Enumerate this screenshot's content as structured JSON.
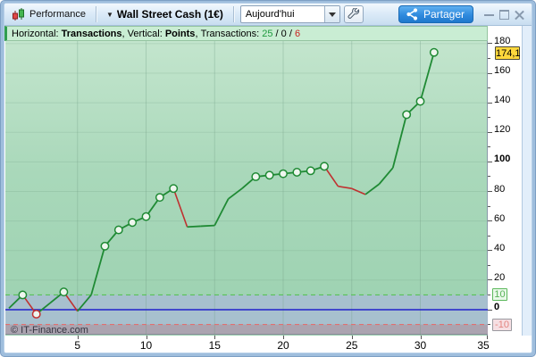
{
  "toolbar": {
    "performance_label": "Performance",
    "instrument_dropdown": "Wall Street Cash (1€)",
    "chevron": "▼",
    "timeframe_value": "Aujourd'hui",
    "share_label": "Partager"
  },
  "info_bar": {
    "horizontal_label": "Horizontal: ",
    "horizontal_value": "Transactions",
    "sep1": ", ",
    "vertical_label": "Vertical: ",
    "vertical_value": "Points",
    "sep2": ", ",
    "transactions_label": "Transactions: ",
    "wins": "25",
    "slash1": " / ",
    "neutral": "0",
    "slash2": " / ",
    "losses": "6"
  },
  "watermark": "© IT-Finance.com",
  "colors": {
    "win_line": "#1f8a34",
    "loss_line": "#c03030",
    "marker_fill": "#eef6ee",
    "zero_line": "#2020cc",
    "upper_threshold": "#58c158",
    "lower_threshold": "#e07070",
    "grid": "#6f9b82",
    "neutral_zone": "#a9bdd1",
    "loss_zone": "#ac9fb0",
    "accent_blue": "#2f8ade",
    "info_green_bg": "#c9edd3",
    "badge_yellow": "#ffd83c"
  },
  "chart_data": {
    "type": "line",
    "title": "Equity curve in points per transaction",
    "xlabel": "Transactions",
    "ylabel": "Points",
    "x": [
      0,
      1,
      2,
      3,
      4,
      5,
      6,
      7,
      8,
      9,
      10,
      11,
      12,
      13,
      14,
      15,
      16,
      17,
      18,
      19,
      20,
      21,
      22,
      23,
      24,
      25,
      26,
      27,
      28,
      29,
      30,
      31
    ],
    "values": [
      1,
      10,
      -3,
      4.5,
      12,
      -1,
      10,
      43,
      54,
      59,
      63,
      76,
      82,
      56,
      56.5,
      57,
      75,
      82,
      90,
      91,
      92,
      93,
      94,
      97,
      83.5,
      82,
      78,
      85,
      96,
      132,
      141,
      174.1
    ],
    "segment_colors": [
      "win",
      "loss",
      "win",
      "win",
      "loss",
      "win",
      "win",
      "win",
      "win",
      "win",
      "win",
      "win",
      "loss",
      "win",
      "win",
      "win",
      "win",
      "win",
      "win",
      "win",
      "win",
      "win",
      "win",
      "loss",
      "loss",
      "loss",
      "win",
      "win",
      "win",
      "win",
      "win"
    ],
    "marker_indices": [
      1,
      2,
      4,
      7,
      8,
      9,
      10,
      11,
      12,
      18,
      19,
      20,
      21,
      22,
      23,
      29,
      30,
      31
    ],
    "loss_marker_indices": [
      2
    ],
    "current_value": 174.1,
    "thresholds": {
      "upper": 10,
      "zero": 0,
      "lower": -10
    },
    "x_ticks": [
      5,
      10,
      15,
      20,
      25,
      30,
      35
    ],
    "y_ticks": [
      0,
      20,
      40,
      60,
      80,
      100,
      120,
      140,
      160,
      180
    ],
    "y_bold_ticks": [
      0,
      100
    ],
    "y_minor_step": 10,
    "xlim": [
      0,
      35.2
    ],
    "ylim": [
      -19,
      182
    ],
    "legend": null,
    "grid": true,
    "badges": {
      "current": "174,1",
      "upper": "10",
      "lower": "-10"
    },
    "stats": {
      "winning": 25,
      "neutral": 0,
      "losing": 6
    }
  }
}
